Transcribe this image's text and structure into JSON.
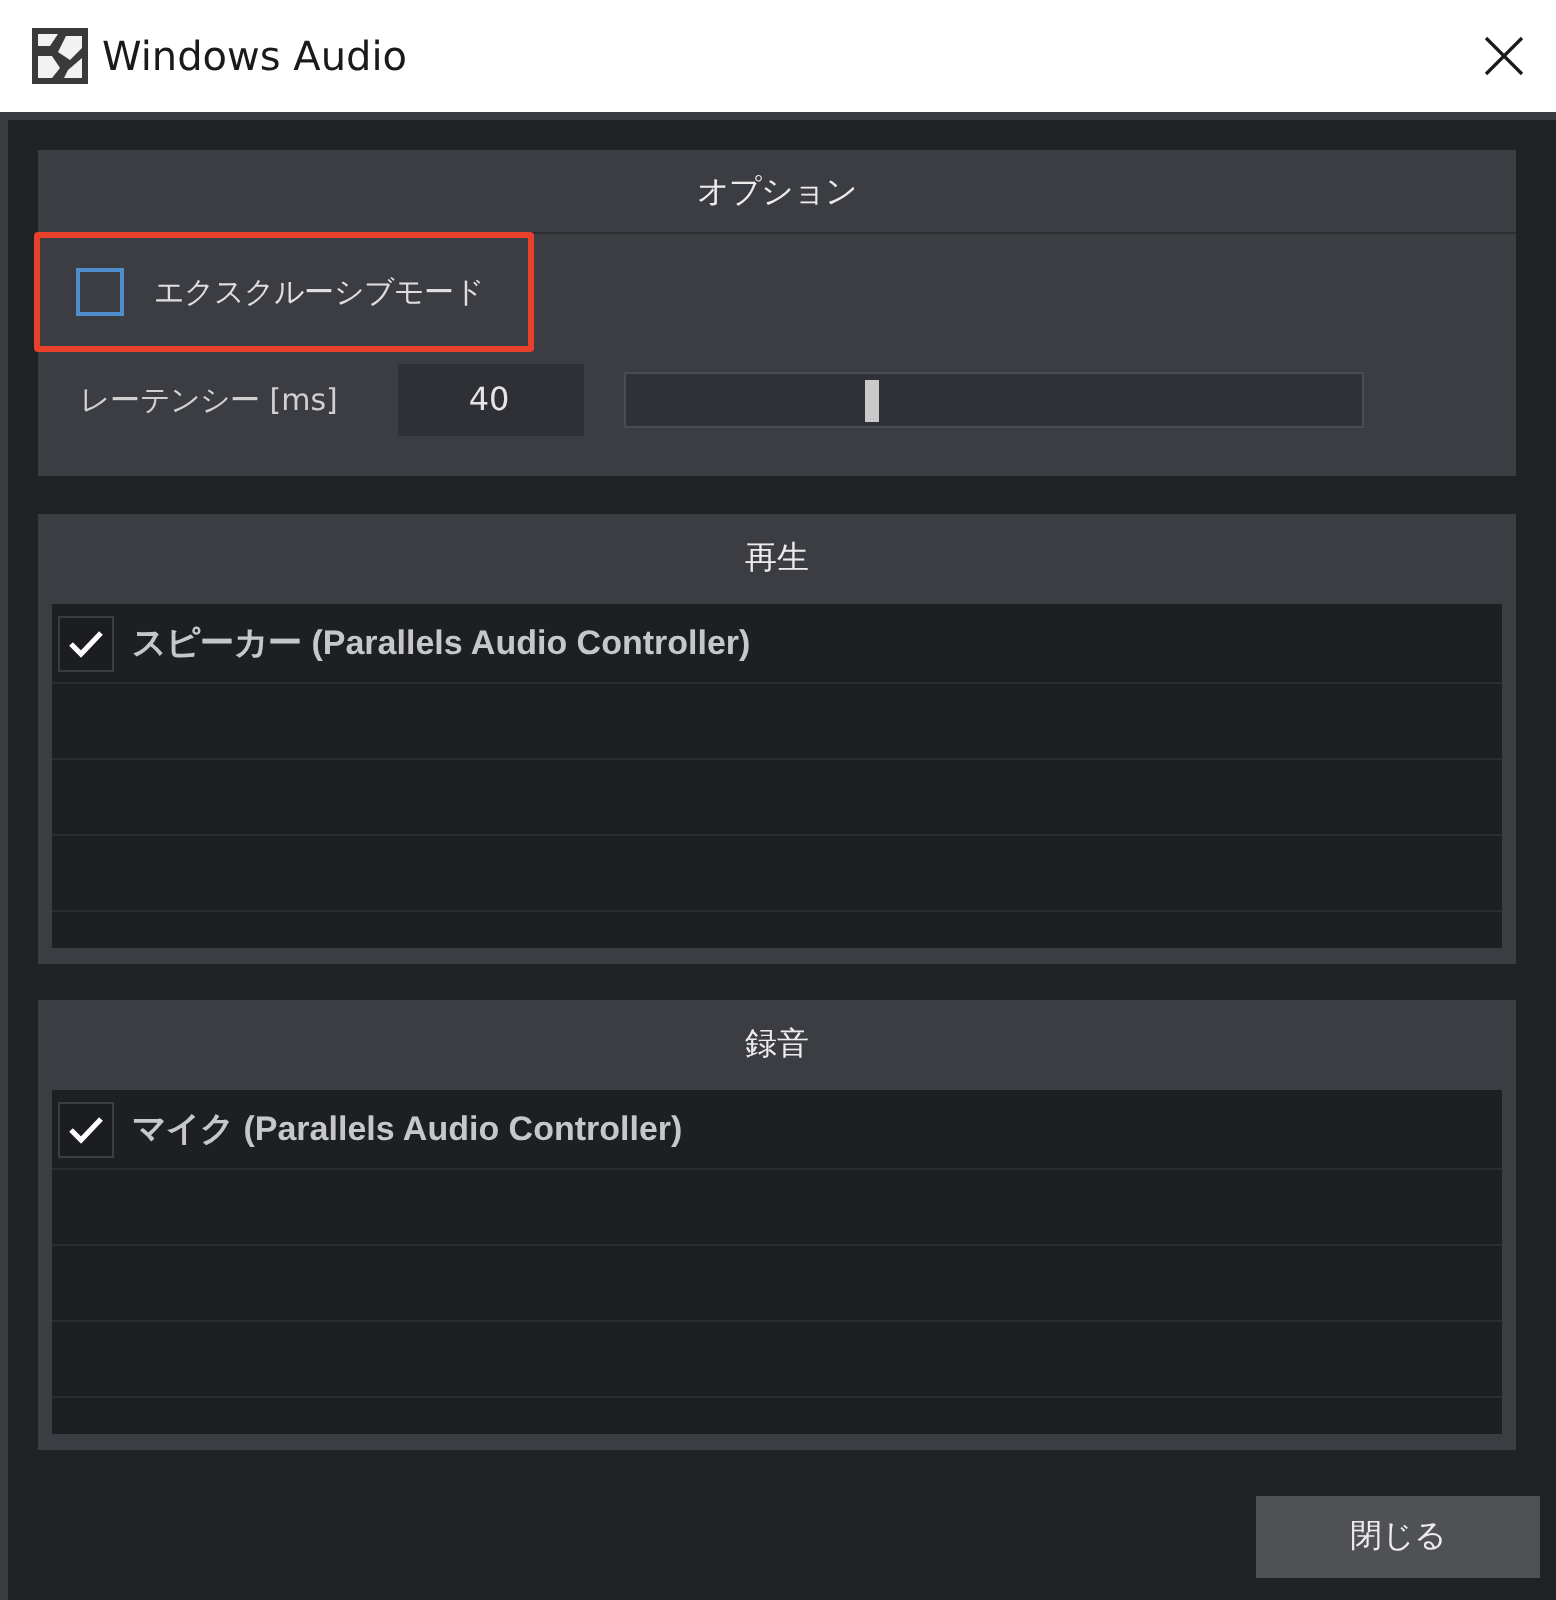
{
  "window": {
    "title": "Windows Audio"
  },
  "options": {
    "title": "オプション",
    "exclusive_mode": {
      "label": "エクスクルーシブモード",
      "checked": false,
      "highlighted": true
    },
    "latency": {
      "label": "レーテンシー [ms]",
      "value": "40",
      "level": 0.335
    }
  },
  "device_sections": [
    {
      "title": "再生",
      "devices": [
        {
          "name": "スピーカー (Parallels Audio Controller)",
          "checked": true
        }
      ]
    },
    {
      "title": "録音",
      "devices": [
        {
          "name": "マイク (Parallels Audio Controller)",
          "checked": true
        }
      ]
    }
  ],
  "buttons": [
    {
      "label": "閉じる"
    }
  ]
}
